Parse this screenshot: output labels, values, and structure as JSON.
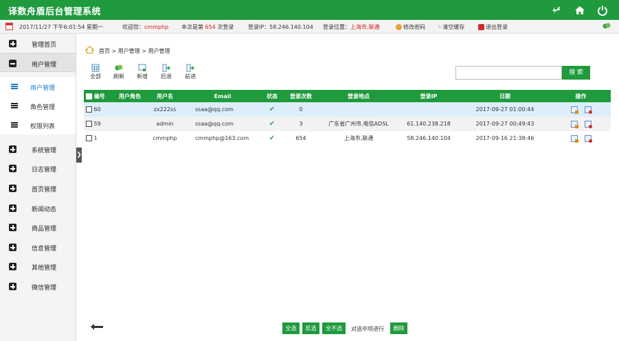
{
  "app": {
    "title": "译数舟盾后台管理系统",
    "accent": "#1f9a3d",
    "icons": [
      "refresh-icon",
      "home-icon",
      "power-icon"
    ]
  },
  "info": {
    "datetime": "2017/11/27 下午6:01:54 星期一",
    "welcome_prefix": "欢迎您：",
    "username": "cmmphp",
    "login_prefix": "本次是第",
    "login_count": "654",
    "login_suffix": "次登录",
    "ip": "登录IP：58.246.140.104",
    "location_prefix": "登录位置：",
    "location": "上海市,联通",
    "change_password": "修改密码",
    "clear_cache": "清空缓存",
    "logout": "退出登录"
  },
  "sidebar": {
    "items": [
      {
        "label": "管理首页"
      },
      {
        "label": "用户管理"
      },
      {
        "label": "系统管理"
      },
      {
        "label": "日志管理"
      },
      {
        "label": "首页管理"
      },
      {
        "label": "新闻动态"
      },
      {
        "label": "商品管理"
      },
      {
        "label": "信息管理"
      },
      {
        "label": "其他管理"
      },
      {
        "label": "微信管理"
      }
    ],
    "subitems": [
      {
        "label": "用户管理"
      },
      {
        "label": "角色管理"
      },
      {
        "label": "权限列表"
      }
    ]
  },
  "breadcrumb": "首页 > 用户管理 > 用户管理",
  "toolbar": {
    "all": "全部",
    "refresh": "刷新",
    "add": "新增",
    "back": "后退",
    "forward": "前进",
    "search_value": "",
    "search_button": "搜 索"
  },
  "table": {
    "headers": [
      "编号",
      "用户角色",
      "用户名",
      "Email",
      "状态",
      "登录次数",
      "登录地点",
      "登录IP",
      "日期",
      "操作"
    ],
    "rows": [
      {
        "id": "60",
        "role": "",
        "username": "zx222ss",
        "email": "ssaa@qq.com",
        "status": "✔",
        "count": "0",
        "place": "",
        "ip": "",
        "date": "2017-09-27 01:00:44"
      },
      {
        "id": "59",
        "role": "",
        "username": "admin",
        "email": "ssaa@qq.com",
        "status": "✔",
        "count": "3",
        "place": "广东省广州市,电信ADSL",
        "ip": "61.140.238.218",
        "date": "2017-09-27 00:49:43"
      },
      {
        "id": "1",
        "role": "",
        "username": "cmmphp",
        "email": "cmmphp@163.com",
        "status": "✔",
        "count": "654",
        "place": "上海市,联通",
        "ip": "58.246.140.104",
        "date": "2017-09-16 21:38:46"
      }
    ]
  },
  "footer": {
    "select_all": "全选",
    "invert": "反选",
    "select_none": "全不选",
    "action_text": "对选中项进行",
    "delete": "删除"
  }
}
